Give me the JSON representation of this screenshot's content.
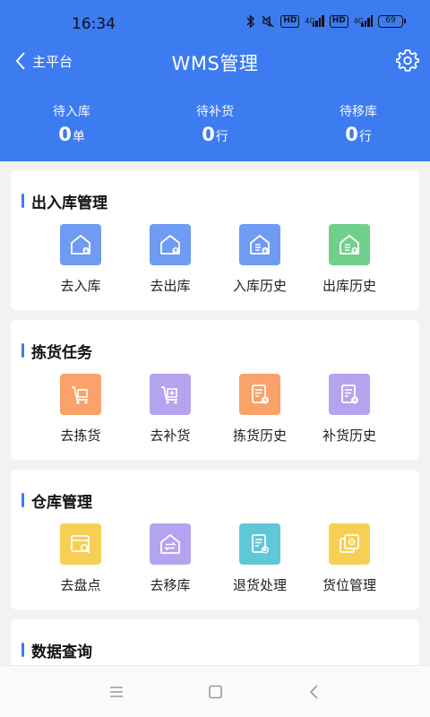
{
  "status_bar": {
    "time": "16:34",
    "hd1": "HD",
    "net1": "4G",
    "hd2": "HD",
    "net2": "4G",
    "battery": "69",
    "icons": [
      "bluetooth-icon",
      "mute-icon",
      "signal-icon",
      "battery-icon"
    ]
  },
  "header": {
    "back_label": "主平台",
    "title": "WMS管理",
    "bg_color": "#3c7bf0",
    "stats": [
      {
        "label": "待入库",
        "value": "0",
        "unit": "单"
      },
      {
        "label": "待补货",
        "value": "0",
        "unit": "行"
      },
      {
        "label": "待移库",
        "value": "0",
        "unit": "行"
      }
    ]
  },
  "sections": [
    {
      "title": "出入库管理",
      "items": [
        {
          "label": "去入库",
          "icon": "warehouse-in-icon",
          "color": "#6f9bf2"
        },
        {
          "label": "去出库",
          "icon": "warehouse-out-icon",
          "color": "#6f9bf2"
        },
        {
          "label": "入库历史",
          "icon": "inbound-history-icon",
          "color": "#6f9bf2"
        },
        {
          "label": "出库历史",
          "icon": "outbound-history-icon",
          "color": "#6fd08c"
        }
      ]
    },
    {
      "title": "拣货任务",
      "items": [
        {
          "label": "去拣货",
          "icon": "cart-icon",
          "color": "#f9a26a"
        },
        {
          "label": "去补货",
          "icon": "cart-add-icon",
          "color": "#b4a3ee"
        },
        {
          "label": "拣货历史",
          "icon": "pick-history-icon",
          "color": "#f9a26a"
        },
        {
          "label": "补货历史",
          "icon": "restock-history-icon",
          "color": "#b4a3ee"
        }
      ]
    },
    {
      "title": "仓库管理",
      "items": [
        {
          "label": "去盘点",
          "icon": "inventory-check-icon",
          "color": "#f7cf52"
        },
        {
          "label": "去移库",
          "icon": "transfer-icon",
          "color": "#b4a3ee"
        },
        {
          "label": "退货处理",
          "icon": "return-icon",
          "color": "#5fc7d8"
        },
        {
          "label": "货位管理",
          "icon": "location-manage-icon",
          "color": "#f7cf52"
        }
      ]
    },
    {
      "title": "数据查询",
      "items": []
    }
  ],
  "nav": {
    "icons": [
      "menu-icon",
      "home-icon",
      "back-nav-icon"
    ]
  }
}
